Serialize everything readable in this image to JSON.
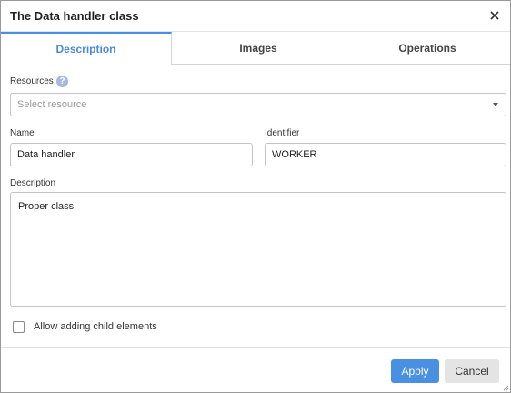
{
  "dialog": {
    "title": "The Data handler class"
  },
  "tabs": [
    {
      "label": "Description",
      "active": true
    },
    {
      "label": "Images",
      "active": false
    },
    {
      "label": "Operations",
      "active": false
    }
  ],
  "resources": {
    "label": "Resources",
    "placeholder": "Select resource",
    "help_icon": "question-icon"
  },
  "name": {
    "label": "Name",
    "value": "Data handler"
  },
  "identifier": {
    "label": "Identifier",
    "value": "WORKER"
  },
  "description": {
    "label": "Description",
    "value": "Proper class"
  },
  "allow_child": {
    "label": "Allow adding child elements",
    "checked": false
  },
  "buttons": {
    "apply": "Apply",
    "cancel": "Cancel"
  },
  "colors": {
    "accent": "#4a90e2",
    "help_badge": "#a8b7e0"
  }
}
